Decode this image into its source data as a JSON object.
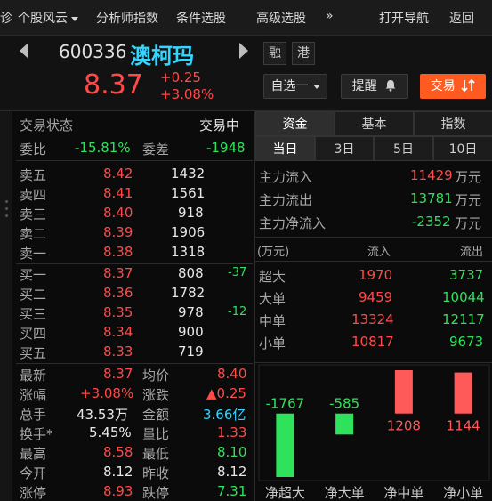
{
  "topnav": {
    "left_clip": "诊",
    "items": [
      {
        "label": "个股风云",
        "dropdown": true
      },
      {
        "label": "分析师指数"
      },
      {
        "label": "条件选股"
      },
      {
        "label": "高级选股"
      },
      {
        "label": "»"
      },
      {
        "label": "打开导航"
      },
      {
        "label": "返回"
      }
    ]
  },
  "stock": {
    "code": "600336",
    "name": "澳柯玛",
    "price": "8.37",
    "change": "+0.25",
    "change_pct": "+3.08%",
    "tags": [
      "融",
      "港"
    ],
    "buttons": {
      "watchlist": "自选一",
      "alert": "提醒",
      "trade": "交易"
    }
  },
  "trade_status": {
    "label": "交易状态",
    "value": "交易中"
  },
  "weibi": {
    "label": "委比",
    "value": "-15.81%",
    "diff_label": "委差",
    "diff_value": "-1948"
  },
  "sell": [
    {
      "label": "卖五",
      "price": "8.42",
      "vol": "1432"
    },
    {
      "label": "卖四",
      "price": "8.41",
      "vol": "1561"
    },
    {
      "label": "卖三",
      "price": "8.40",
      "vol": "918"
    },
    {
      "label": "卖二",
      "price": "8.39",
      "vol": "1906"
    },
    {
      "label": "卖一",
      "price": "8.38",
      "vol": "1318"
    }
  ],
  "buy": [
    {
      "label": "买一",
      "price": "8.37",
      "vol": "808",
      "chg": "-37"
    },
    {
      "label": "买二",
      "price": "8.36",
      "vol": "1782",
      "chg": ""
    },
    {
      "label": "买三",
      "price": "8.35",
      "vol": "978",
      "chg": "-12"
    },
    {
      "label": "买四",
      "price": "8.34",
      "vol": "900",
      "chg": ""
    },
    {
      "label": "买五",
      "price": "8.33",
      "vol": "719",
      "chg": ""
    }
  ],
  "stats": [
    {
      "l1": "最新",
      "v1": "8.37",
      "l2": "均价",
      "v2": "8.40"
    },
    {
      "l1": "涨幅",
      "v1": "+3.08%",
      "l2": "涨跌",
      "v2": "▲0.25"
    },
    {
      "l1": "总手",
      "v1": "43.53万",
      "l2": "金额",
      "v2": "3.66亿"
    },
    {
      "l1": "换手*",
      "v1": "5.45%",
      "l2": "量比",
      "v2": "1.33"
    },
    {
      "l1": "最高",
      "v1": "8.58",
      "l2": "最低",
      "v2": "8.10"
    },
    {
      "l1": "今开",
      "v1": "8.12",
      "l2": "昨收",
      "v2": "8.12"
    },
    {
      "l1": "涨停",
      "v1": "8.93",
      "l2": "跌停",
      "v2": "7.31"
    }
  ],
  "tabs_main": [
    "资金",
    "基本",
    "指数"
  ],
  "tabs_period": [
    "当日",
    "3日",
    "5日",
    "10日"
  ],
  "flow_summary": [
    {
      "label": "主力流入",
      "value": "11429",
      "unit": "万元"
    },
    {
      "label": "主力流出",
      "value": "13781",
      "unit": "万元"
    },
    {
      "label": "主力净流入",
      "value": "-2352",
      "unit": "万元"
    }
  ],
  "flow_table": {
    "header": {
      "unit": "(万元)",
      "in": "流入",
      "out": "流出"
    },
    "rows": [
      {
        "label": "超大",
        "in": "1970",
        "out": "3737"
      },
      {
        "label": "大单",
        "in": "9459",
        "out": "10044"
      },
      {
        "label": "中单",
        "in": "13324",
        "out": "12117"
      },
      {
        "label": "小单",
        "in": "10817",
        "out": "9673"
      }
    ]
  },
  "chart_data": {
    "type": "bar",
    "categories": [
      "净超大",
      "净大单",
      "净中单",
      "净小单"
    ],
    "values": [
      -1767,
      -585,
      1208,
      1144
    ],
    "colors": {
      "positive": "#ff5a5a",
      "negative": "#2ee35b"
    }
  }
}
